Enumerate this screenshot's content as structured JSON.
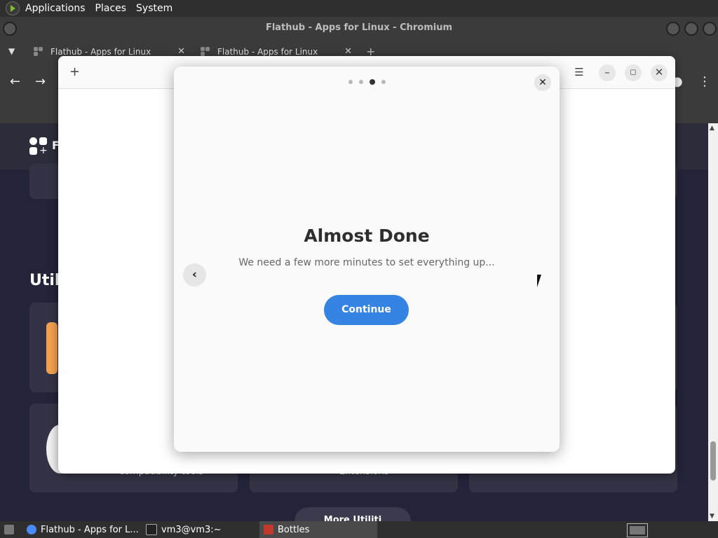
{
  "system_panel": {
    "menus": [
      "Applications",
      "Places",
      "System"
    ]
  },
  "browser": {
    "window_title": "Flathub - Apps for Linux - Chromium",
    "tabs": [
      {
        "label": "Flathub - Apps for Linux"
      },
      {
        "label": "Flathub - Apps for Linux"
      }
    ]
  },
  "page": {
    "site_name_partial": "F",
    "section_title_partial": "Util",
    "card_subtitles": [
      "compatibility tools",
      "Extensions"
    ],
    "more_button_partial": "More Utiliti"
  },
  "dialog": {
    "pager": {
      "total": 4,
      "active_index": 2
    },
    "title": "Almost Done",
    "subtitle": "We need a few more minutes to set everything up...",
    "continue_label": "Continue"
  },
  "taskbar": {
    "items": [
      {
        "label": "Flathub - Apps for L..."
      },
      {
        "label": "vm3@vm3:~"
      },
      {
        "label": "Bottles"
      }
    ]
  },
  "colors": {
    "accent": "#3584e4",
    "page_bg": "#23233a",
    "chrome_bg": "#3b3b3b"
  }
}
